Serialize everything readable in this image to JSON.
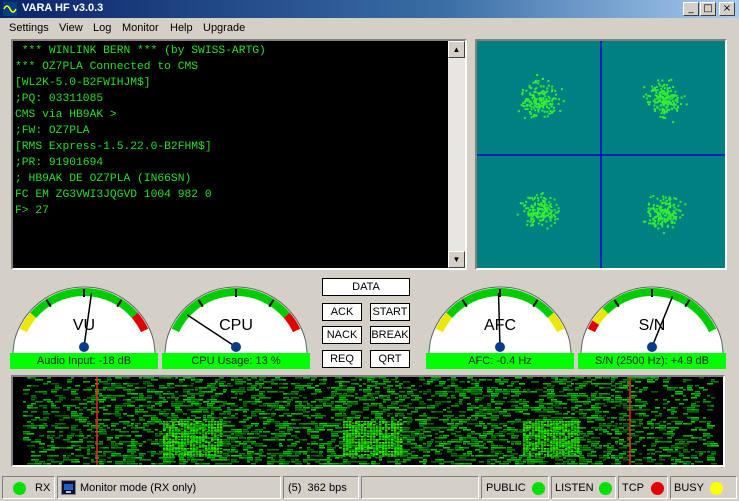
{
  "window": {
    "title": "VARA HF v3.0.3",
    "minimize_glyph": "_",
    "maximize_glyph": "□",
    "close_glyph": "×"
  },
  "menu": [
    "Settings",
    "View",
    "Log",
    "Monitor",
    "Help",
    "Upgrade"
  ],
  "terminal": {
    "lines": [
      " *** WINLINK BERN *** (by SWISS-ARTG)",
      "*** OZ7PLA Connected to CMS",
      "[WL2K-5.0-B2FWIHJM$]",
      ";PQ: 03311085",
      "CMS via HB9AK >",
      ";FW: OZ7PLA",
      "[RMS Express-1.5.22.0-B2FHM$]",
      ";PR: 91901694",
      "; HB9AK DE OZ7PLA (IN66SN)",
      "FC EM ZG3VWI3JQGVD 1004 982 0",
      "F> 27"
    ],
    "scroll_up_glyph": "▲",
    "scroll_down_glyph": "▼"
  },
  "gauges": {
    "vu": {
      "label": "VU",
      "status": "Audio Input: -18 dB",
      "level": 0.55
    },
    "cpu": {
      "label": "CPU",
      "status": "CPU Usage: 13 %",
      "level": 0.13
    },
    "afc": {
      "label": "AFC",
      "status": "AFC: -0.4 Hz",
      "level": 0.49
    },
    "sn": {
      "label": "S/N",
      "status": "S/N (2500 Hz): +4.9 dB",
      "level": 0.64
    }
  },
  "controls": {
    "data": "DATA",
    "ack": "ACK",
    "start": "START",
    "nack": "NACK",
    "break": "BREAK",
    "req": "REQ",
    "qrt": "QRT"
  },
  "status": {
    "rx": "RX",
    "monitor_mode": "Monitor mode (RX only)",
    "speed": "(5)  362 bps",
    "public": "PUBLIC",
    "listen": "LISTEN",
    "tcp": "TCP",
    "busy": "BUSY"
  },
  "colors": {
    "terminal_text": "#22e022",
    "led_green": "#00e000",
    "led_red": "#e00000",
    "led_yellow": "#ffff00",
    "gauge_bar": "#00ff00",
    "constellation_bg": "#018082",
    "constellation_points": "#33ee33"
  }
}
